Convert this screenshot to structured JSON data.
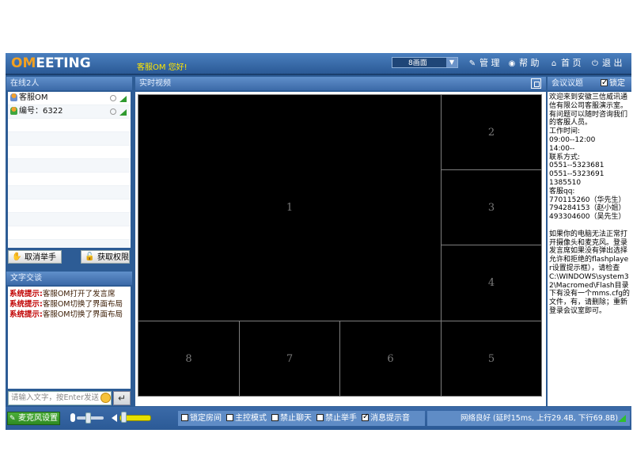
{
  "app": {
    "logo_prefix": "OM",
    "logo_suffix": "EETING",
    "greeting": "客服OM 您好!"
  },
  "toolbar": {
    "layout_select": "8画面",
    "manage": "管 理",
    "help": "帮 助",
    "home": "首 页",
    "exit": "退 出",
    "icons": [
      "wrench-icon",
      "help-circle-icon",
      "home-icon",
      "power-icon"
    ]
  },
  "online": {
    "header": "在线2人",
    "users": [
      {
        "name": "客服OM",
        "avatar": "orange"
      },
      {
        "name": "编号：6322",
        "avatar": "green"
      }
    ],
    "cancel_hand_label": "取消举手",
    "get_permission_label": "获取权限"
  },
  "chat": {
    "header": "文字交谈",
    "messages": [
      {
        "label": "系统提示:",
        "text": "客服OM打开了发言席"
      },
      {
        "label": "系统提示:",
        "text": "客服OM切换了界面布局"
      },
      {
        "label": "系统提示:",
        "text": "客服OM切换了界面布局"
      }
    ],
    "input_placeholder": "请输入文字，按Enter发送"
  },
  "video": {
    "header": "实时视频",
    "cells": [
      "1",
      "2",
      "3",
      "4",
      "5",
      "6",
      "7",
      "8"
    ]
  },
  "meeting": {
    "header": "会议议题",
    "lock_label": "锁定",
    "lock_checked": true,
    "text": "欢迎来到安徽三信威讯通信有限公司客服演示室。有问题可以随时咨询我们的客服人员。\n工作时间:\n09:00--12:00\n14:00--\n联系方式:\n0551--5323681\n0551--5323691\n1385510\n客服qq:\n770115260（华先生）\n794284153（赵小姐）\n493304600（吴先生）\n\n如果你的电脑无法正常打开摄像头和麦克风。登录发言席如果没有弹出选择允许和拒绝的flashplayer设置提示框），请检查C:\\WINDOWS\\system32\\Macromed\\Flash目录下有没有一个mms.cfg的文件，有，请删除；重新登录会议室即可。"
  },
  "bottom": {
    "mic_settings_label": "麦克风设置",
    "mic_level": 0.35,
    "volume_level": 0.95,
    "options": [
      {
        "label": "锁定房间",
        "checked": false
      },
      {
        "label": "主控模式",
        "checked": false
      },
      {
        "label": "禁止聊天",
        "checked": false
      },
      {
        "label": "禁止举手",
        "checked": false
      },
      {
        "label": "消息提示音",
        "checked": true
      }
    ],
    "network_status": "网络良好 (延时15ms, 上行29.4B, 下行69.8B)"
  },
  "colors": {
    "frame": "#2d5c95",
    "system_label": "#c00000",
    "greeting": "#ffe600",
    "logo_accent": "#f2a021",
    "signal": "#2f9a2f"
  }
}
